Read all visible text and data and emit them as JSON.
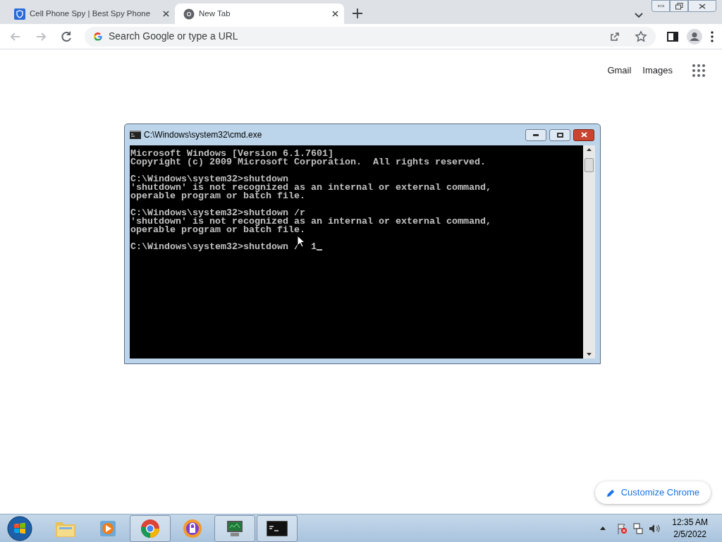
{
  "tabs": [
    {
      "title": "Cell Phone Spy | Best Spy Phone",
      "selected": false,
      "kind": "shield"
    },
    {
      "title": "New Tab",
      "selected": true,
      "kind": "chrome"
    }
  ],
  "omnibox": {
    "placeholder": "Search Google or type a URL"
  },
  "top_links": [
    "Gmail",
    "Images"
  ],
  "customize_button": "Customize Chrome",
  "console_window": {
    "title": "C:\\Windows\\system32\\cmd.exe",
    "blocks": [
      [
        "Microsoft Windows [Version 6.1.7601]",
        "Copyright (c) 2009 Microsoft Corporation.  All rights reserved."
      ],
      [
        "C:\\Windows\\system32>shutdown",
        "'shutdown' is not recognized as an internal or external command,",
        "operable program or batch file."
      ],
      [
        "C:\\Windows\\system32>shutdown /r",
        "'shutdown' is not recognized as an internal or external command,",
        "operable program or batch file."
      ],
      [
        "C:\\Windows\\system32>shutdown /  1"
      ]
    ]
  },
  "taskbar": {
    "apps": [
      {
        "kind": "folder",
        "active": false
      },
      {
        "kind": "media",
        "active": false
      },
      {
        "kind": "chrome",
        "active": true
      },
      {
        "kind": "shield",
        "active": false
      },
      {
        "kind": "monitor",
        "active": true
      },
      {
        "kind": "console",
        "active": true
      }
    ],
    "time": "12:35 AM",
    "date": "2/5/2022"
  }
}
